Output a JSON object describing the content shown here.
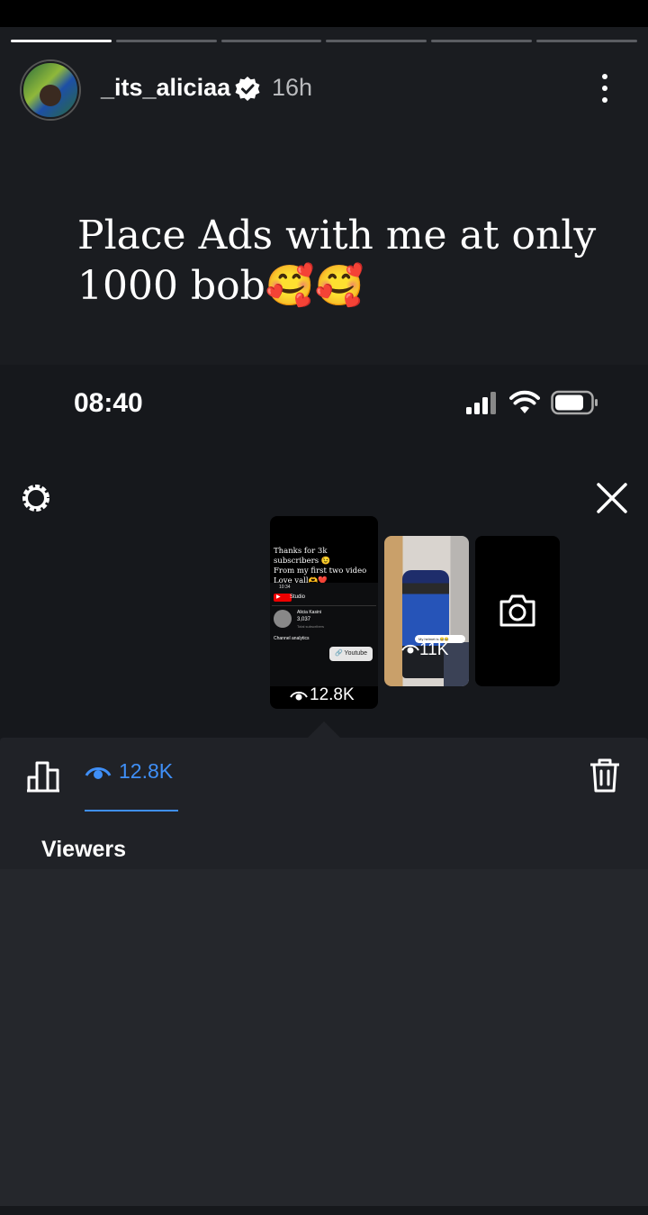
{
  "story": {
    "progress_segments": 6,
    "active_segment": 0,
    "username": "_its_aliciaa",
    "time_ago": "16h",
    "caption": "Place Ads with me at only 1000 bob🥰🥰",
    "icons": {
      "verified": "verified-badge-icon",
      "more": "more-options-icon"
    }
  },
  "screenshot": {
    "status_bar": {
      "time": "08:40"
    },
    "thumbnails": [
      {
        "caption_lines": [
          "Thanks for 3k subscribers 😉",
          "From my first two video",
          "Love yall🫶❤️"
        ],
        "mini": {
          "time": "10:34",
          "studio_label": "Studio",
          "channel_name": "Alicia Kasini",
          "count": "3,037",
          "sub": "Total subscribers",
          "analytics": "Channel analytics",
          "link_label": "Youtube"
        },
        "views": "12.8K"
      },
      {
        "chip": "My helmet is 😂😂",
        "views": "11K"
      },
      {
        "type": "camera"
      }
    ],
    "tabs": {
      "views_count": "12.8K"
    },
    "viewers_label": "Viewers",
    "colors": {
      "accent": "#3f8ff7",
      "panel": "#202227"
    }
  }
}
